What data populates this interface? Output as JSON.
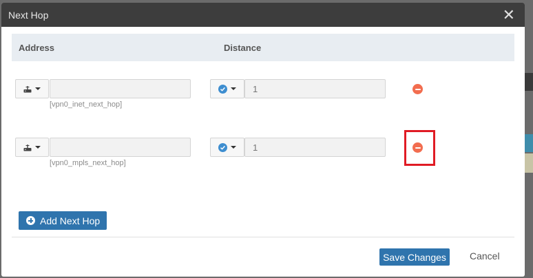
{
  "dialog": {
    "title": "Next Hop"
  },
  "table": {
    "columns": {
      "address": "Address",
      "distance": "Distance"
    },
    "rows": [
      {
        "address_value": "",
        "hint": "[vpn0_inet_next_hop]",
        "distance_placeholder": "1",
        "interface_icon": "router-icon",
        "distance_icon": "check-circle-icon"
      },
      {
        "address_value": "",
        "hint": "[vpn0_mpls_next_hop]",
        "distance_placeholder": "1",
        "interface_icon": "router-icon",
        "distance_icon": "check-circle-icon",
        "highlighted": true
      }
    ]
  },
  "buttons": {
    "add": "Add Next Hop",
    "save": "Save Changes",
    "cancel": "Cancel"
  },
  "icons": {
    "close": "close-icon",
    "add": "plus-circle-icon",
    "remove": "minus-circle-icon"
  },
  "colors": {
    "header": "#3d3d3d",
    "primary": "#2f74ad",
    "remove": "#f26d4f",
    "highlight": "#e01b24",
    "check": "#3e8ed0"
  },
  "close_glyph": "✕"
}
